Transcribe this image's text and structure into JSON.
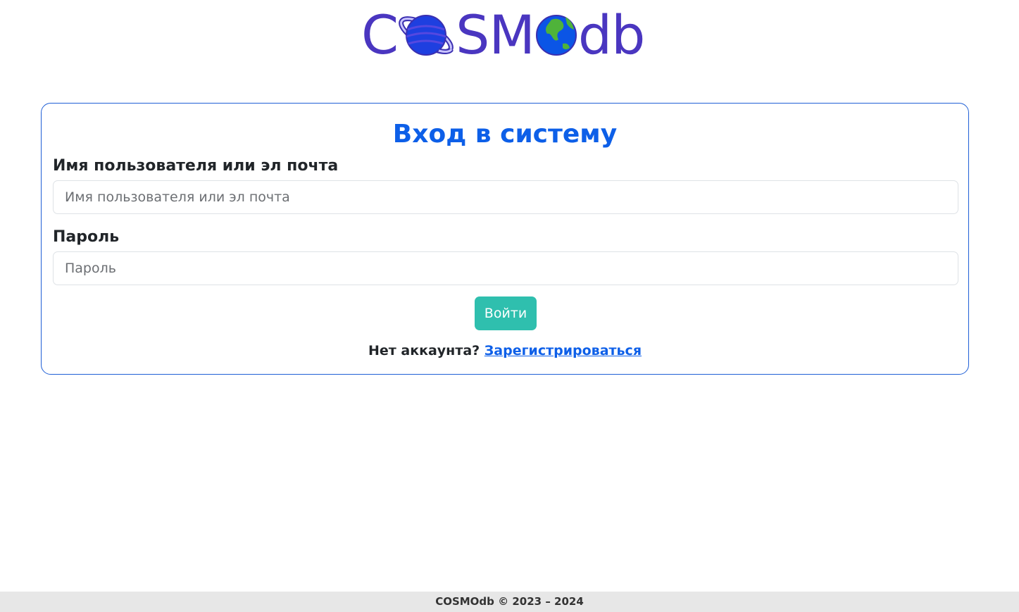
{
  "logo": {
    "text_before": "C",
    "text_middle": "SM",
    "text_after": "db",
    "planet_icon": "ringed-planet-icon",
    "earth_icon": "earth-globe-icon",
    "colors": {
      "text": "#4a36c0",
      "planet": "#1e3fe0",
      "ring": "#6f5cf0",
      "earth_ocean": "#0b55e6",
      "earth_land": "#4fb33a"
    }
  },
  "login": {
    "title": "Вход в систему",
    "username_label": "Имя пользователя или эл почта",
    "username_placeholder": "Имя пользователя или эл почта",
    "username_value": "",
    "password_label": "Пароль",
    "password_placeholder": "Пароль",
    "password_value": "",
    "submit_label": "Войти",
    "no_account_text": "Нет аккаунта?",
    "register_link": "Зарегистрироваться"
  },
  "colors": {
    "accent": "#0d5fe8",
    "button": "#2fbfae",
    "card_border": "#1f5fd6",
    "footer_bg": "#e7e7e7"
  },
  "footer": {
    "text": "COSMOdb © 2023 – 2024"
  }
}
